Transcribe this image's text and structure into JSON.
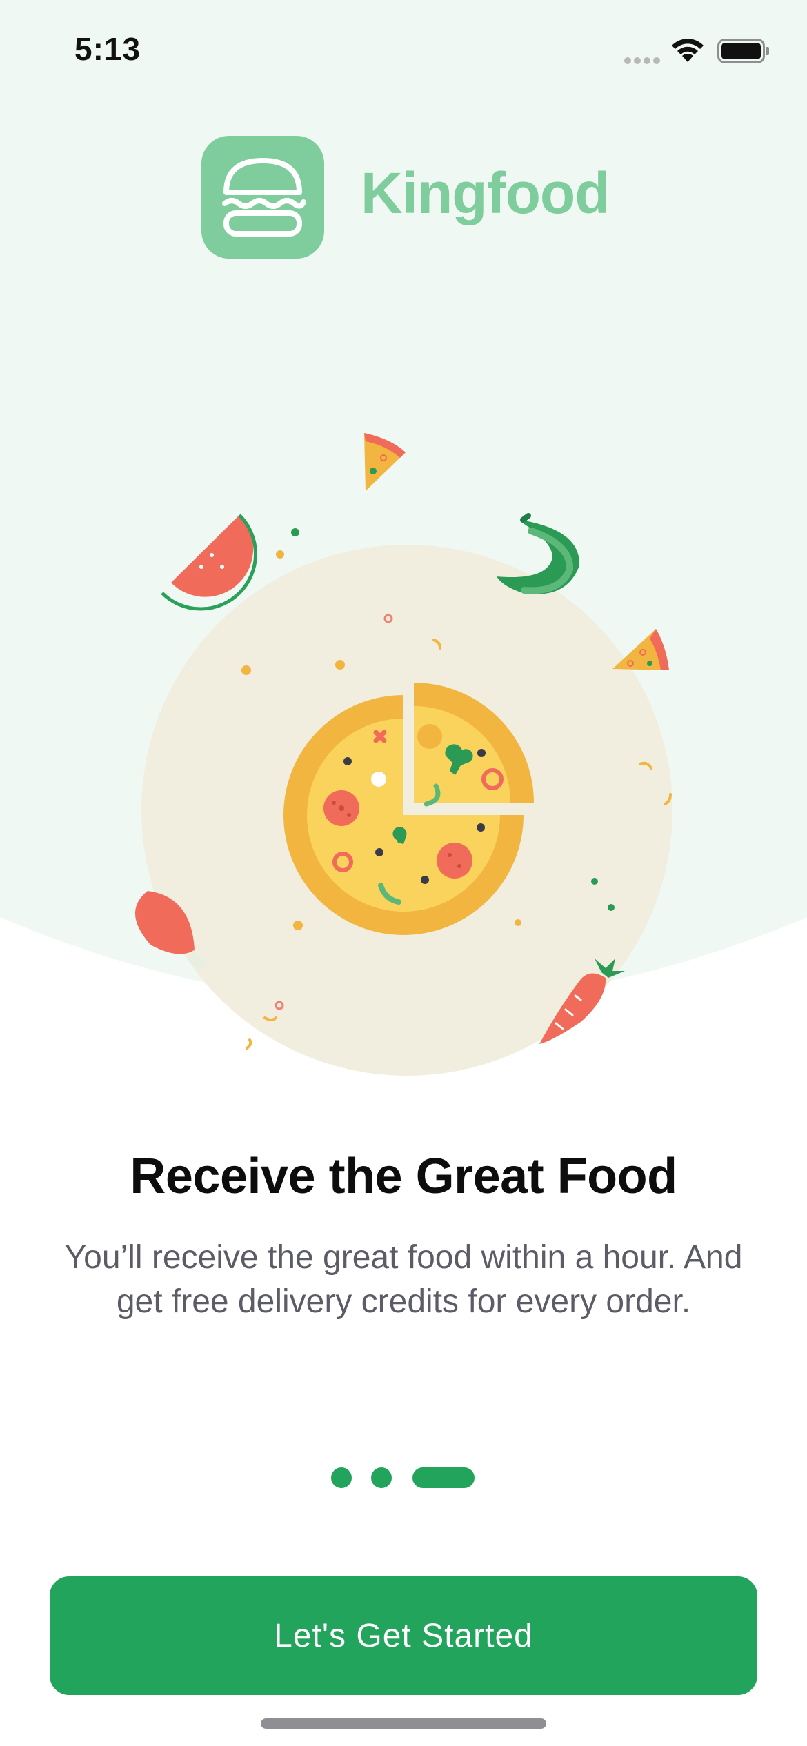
{
  "status_bar": {
    "time": "5:13"
  },
  "brand": {
    "name": "Kingfood",
    "logo_icon": "burger-icon",
    "color": "#7fcc9c"
  },
  "onboarding": {
    "title": "Receive the Great Food",
    "subtitle": "You’ll receive the great food within a hour. And get free delivery credits for every order.",
    "pagination": {
      "total": 3,
      "active_index": 2
    },
    "cta_label": "Let's Get Started"
  },
  "colors": {
    "accent": "#22a45d",
    "background_tint": "#eff8f2",
    "illustration_circle": "#f2eedf"
  },
  "icons": {
    "signal": "cellular-signal-icon",
    "wifi": "wifi-icon",
    "battery": "battery-icon"
  }
}
